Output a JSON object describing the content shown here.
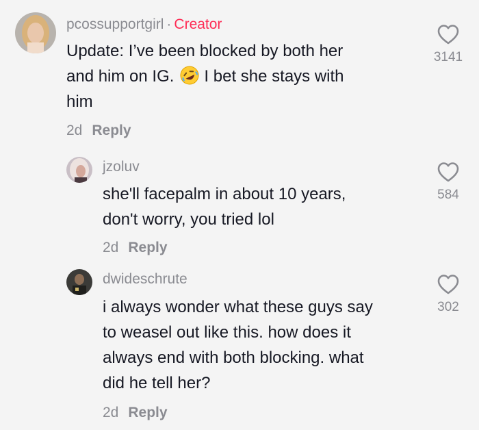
{
  "comments": [
    {
      "username": "pcossupportgirl",
      "separator": "·",
      "badge": "Creator",
      "lines": [
        "Update: I’ve been blocked by both her",
        "and him on IG.",
        "I bet she stays with",
        "him"
      ],
      "emoji": "rolling-on-floor-laughing-emoji",
      "age": "2d",
      "reply_label": "Reply",
      "likes": "3141"
    },
    {
      "username": "jzoluv",
      "lines": [
        "she'll facepalm in about 10 years,",
        "don't worry, you tried lol"
      ],
      "age": "2d",
      "reply_label": "Reply",
      "likes": "584"
    },
    {
      "username": "dwideschrute",
      "lines": [
        "i always wonder what these guys say",
        "to weasel out like this. how does it",
        "always end with both blocking. what",
        "did he tell her?"
      ],
      "age": "2d",
      "reply_label": "Reply",
      "likes": "302"
    }
  ],
  "icons": {
    "like": "heart-outline-icon"
  },
  "colors": {
    "background": "#f4f4f4",
    "text": "#161823",
    "muted": "#8a8b91",
    "creator_badge": "#fe2c55"
  }
}
